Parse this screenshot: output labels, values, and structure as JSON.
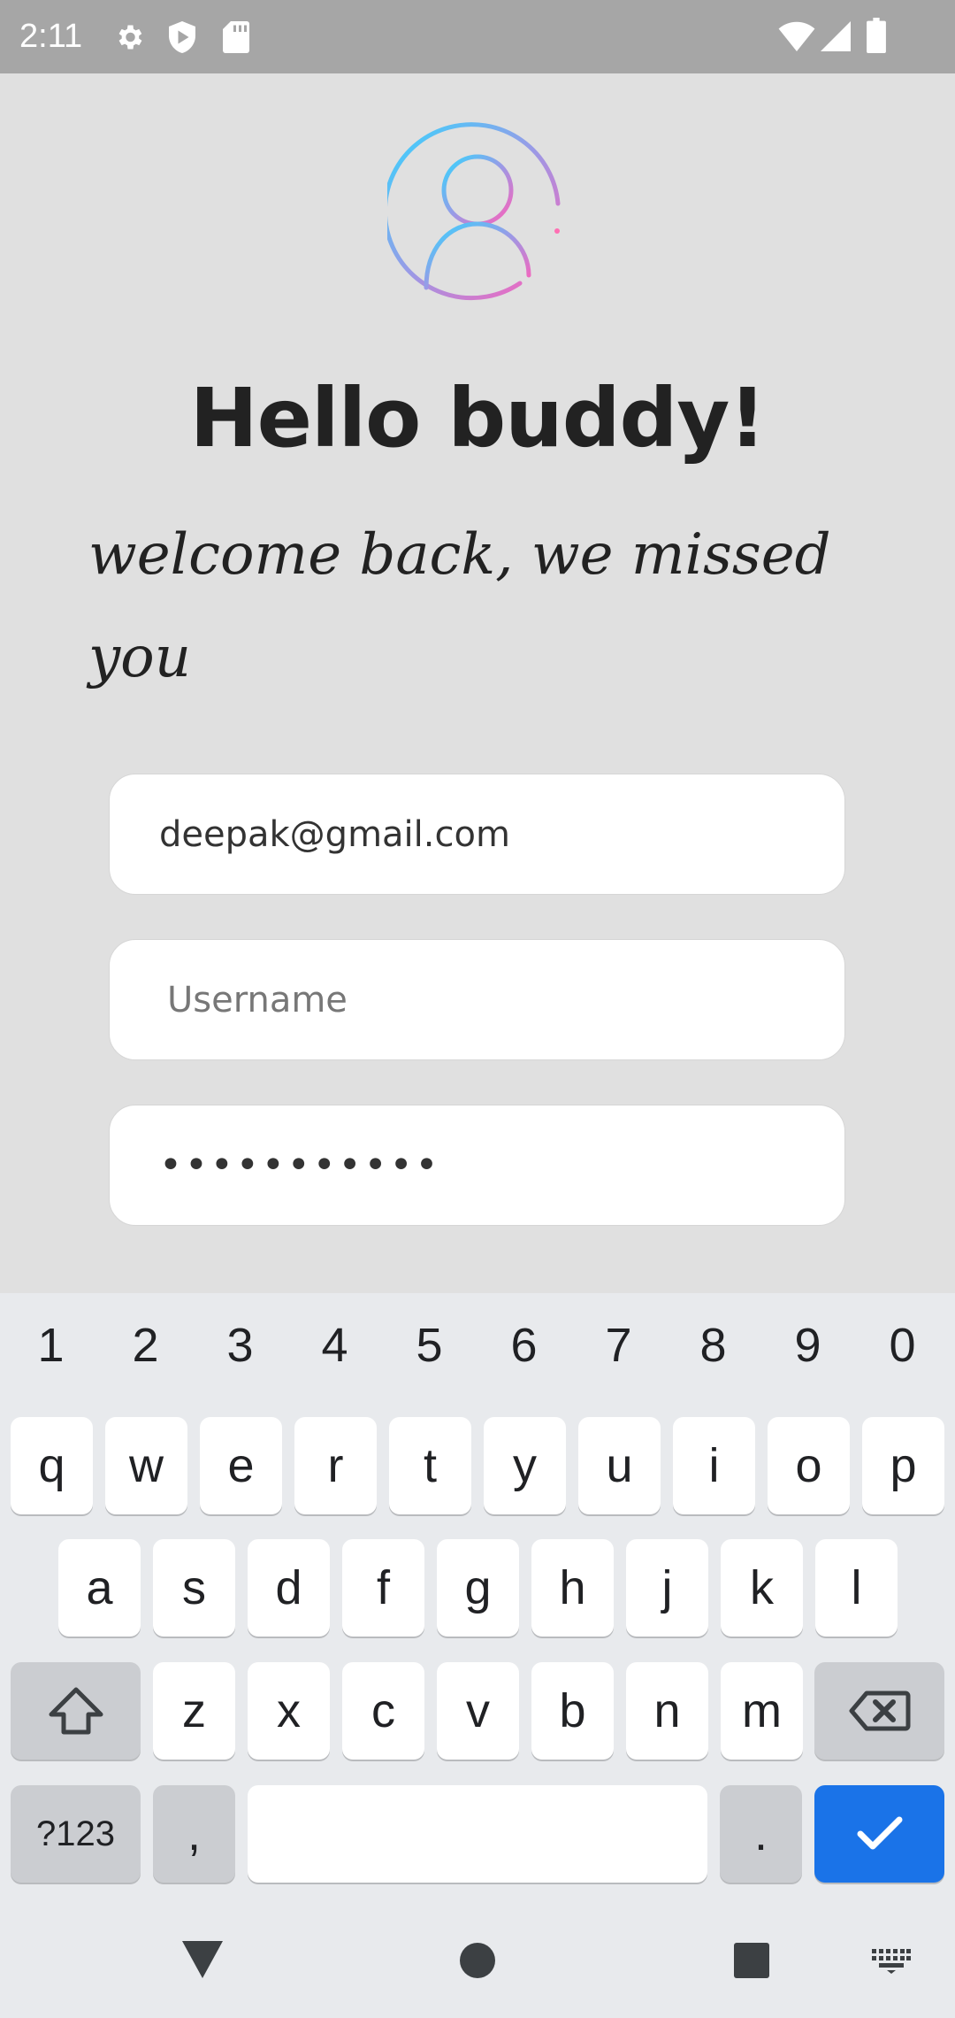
{
  "status_bar": {
    "time": "2:11",
    "left_icons": [
      "settings-icon",
      "shield-play-icon",
      "sd-card-icon"
    ],
    "right_icons": [
      "wifi-icon",
      "cell-signal-icon",
      "battery-icon"
    ]
  },
  "header": {
    "title": "Hello buddy!",
    "subtitle": "welcome back, we missed you"
  },
  "form": {
    "email_value": "deepak@gmail.com",
    "username_placeholder": "Username",
    "password_mask": "•••••••••••"
  },
  "keyboard": {
    "numbers": [
      "1",
      "2",
      "3",
      "4",
      "5",
      "6",
      "7",
      "8",
      "9",
      "0"
    ],
    "row1": [
      "q",
      "w",
      "e",
      "r",
      "t",
      "y",
      "u",
      "i",
      "o",
      "p"
    ],
    "row2": [
      "a",
      "s",
      "d",
      "f",
      "g",
      "h",
      "j",
      "k",
      "l"
    ],
    "row3": [
      "z",
      "x",
      "c",
      "v",
      "b",
      "n",
      "m"
    ],
    "symbols_label": "?123",
    "comma": ",",
    "period": ".",
    "accent_color": "#1a73e8"
  },
  "nav_bar": {
    "icons": [
      "back-icon",
      "home-icon",
      "recents-icon",
      "keyboard-switch-icon"
    ]
  }
}
